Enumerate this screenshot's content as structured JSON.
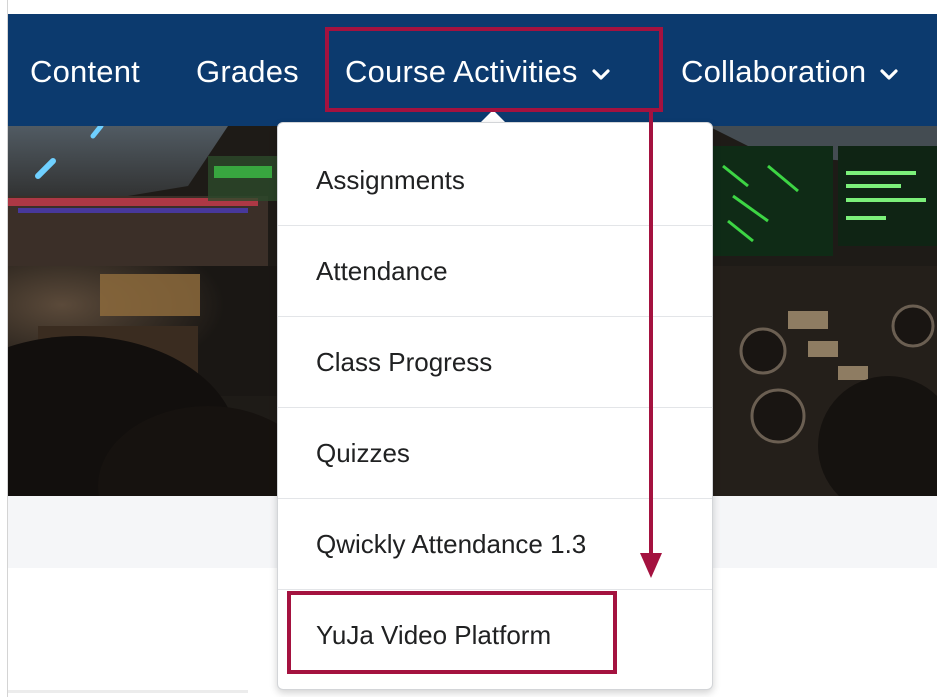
{
  "nav": {
    "items": [
      {
        "label": "Content"
      },
      {
        "label": "Grades"
      },
      {
        "label": "Course Activities",
        "dropdown": true,
        "highlighted": true
      },
      {
        "label": "Collaboration",
        "dropdown": true
      }
    ]
  },
  "dropdown": {
    "items": [
      {
        "label": "Assignments"
      },
      {
        "label": "Attendance"
      },
      {
        "label": "Class Progress"
      },
      {
        "label": "Quizzes"
      },
      {
        "label": "Qwickly Attendance 1.3"
      },
      {
        "label": "YuJa Video Platform",
        "highlighted": true
      }
    ]
  },
  "icons": {
    "dropdown_chevron": "chevron-down-icon"
  },
  "colors": {
    "navbar": "#0c3a6e",
    "highlight": "#a4123f",
    "menu_text": "#202122"
  },
  "hero": {
    "description_icon": "cockpit-banner-image"
  }
}
